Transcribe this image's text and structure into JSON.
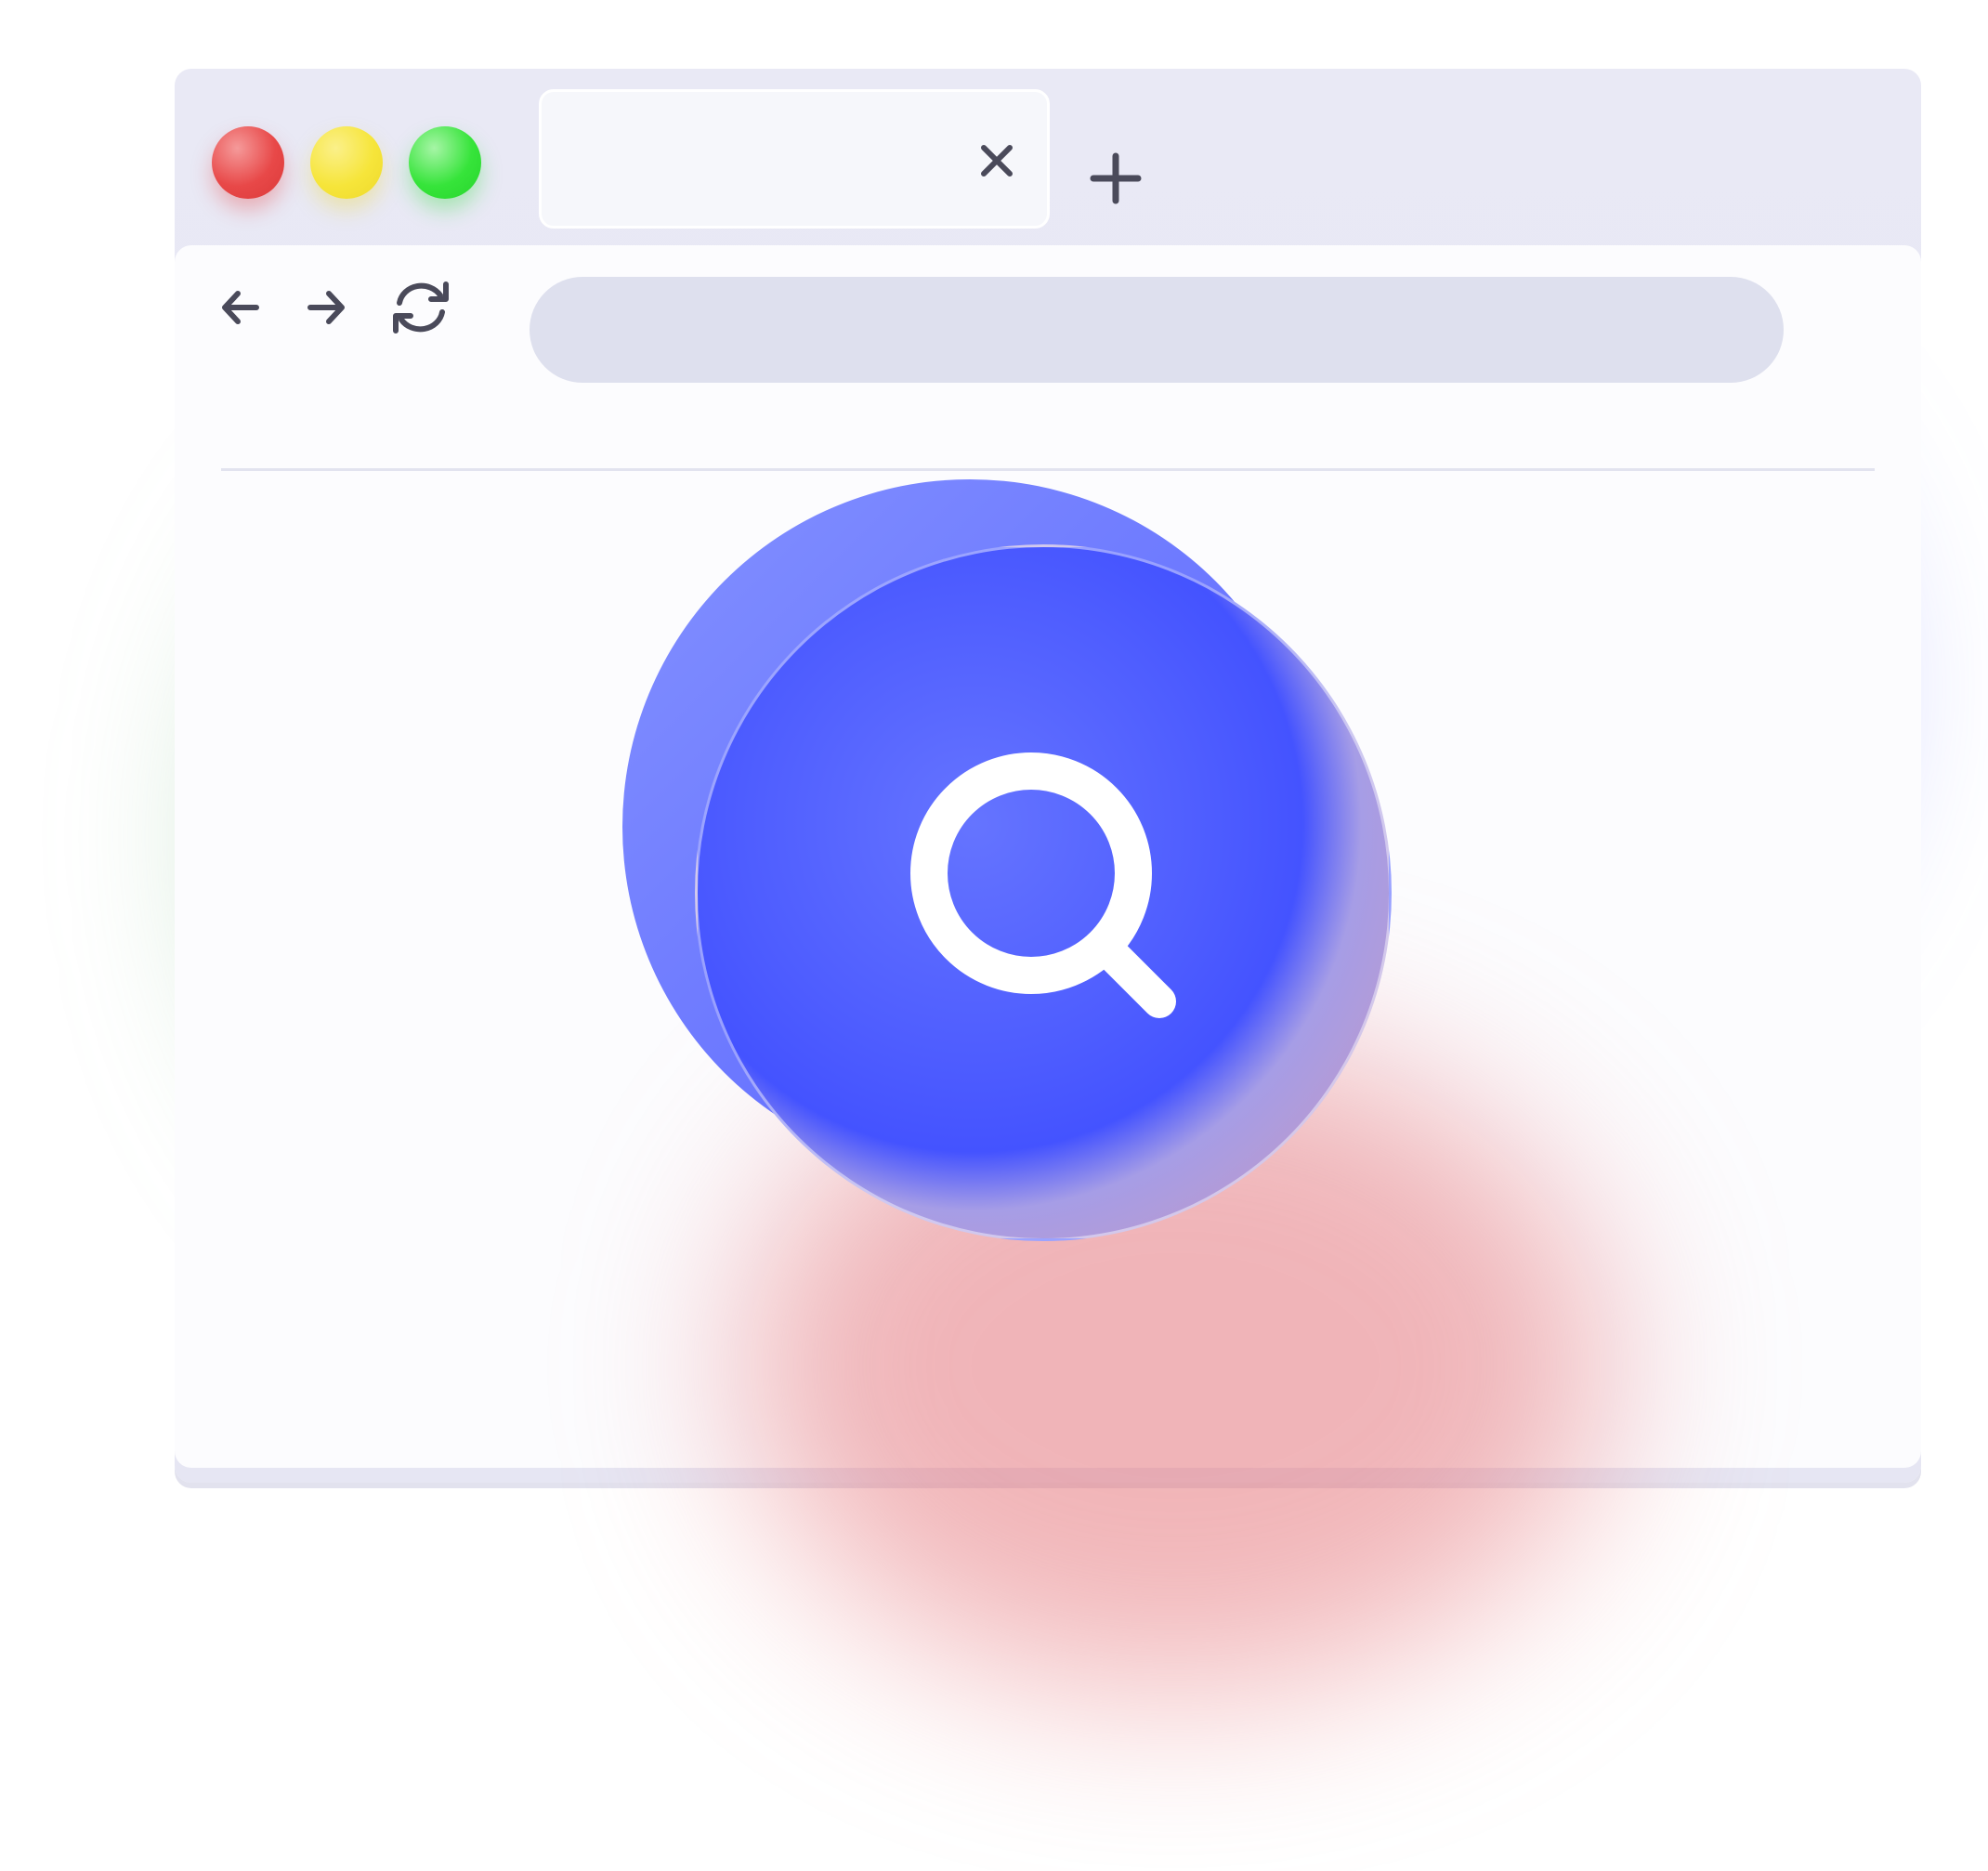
{
  "window": {
    "controls": {
      "close_color": "#e84848",
      "minimize_color": "#f6e53a",
      "maximize_color": "#36e43a"
    },
    "tabs": [
      {
        "title": "",
        "close_icon": "close-icon"
      }
    ],
    "new_tab_icon": "plus-icon"
  },
  "toolbar": {
    "back_icon": "arrow-left-icon",
    "forward_icon": "arrow-right-icon",
    "reload_icon": "refresh-icon",
    "address_bar": {
      "value": "",
      "placeholder": ""
    }
  },
  "illustration": {
    "icon": "search-icon",
    "accent_color": "#4453ff",
    "glow_colors": [
      "#78b982",
      "#5f6eff",
      "#e6787d"
    ]
  }
}
